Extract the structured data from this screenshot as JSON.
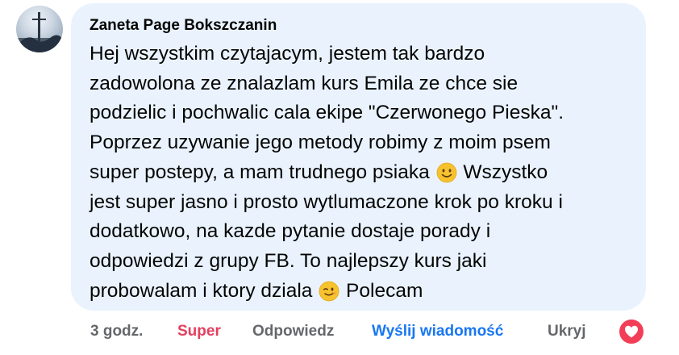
{
  "comment": {
    "author": "Zaneta Page Bokszczanin",
    "lines": {
      "l1": "Hej wszystkim czytajacym, jestem tak bardzo",
      "l2": "zadowolona ze znalazlam kurs Emila ze chce sie",
      "l3": "podzielic i pochwalic cala ekipe \"Czerwonego Pieska\".",
      "l4": "Poprzez uzywanie jego metody robimy z moim psem",
      "l5a": "super postepy, a mam trudnego psiaka ",
      "l5b": " Wszystko",
      "l6": "jest super jasno i prosto wytlumaczone krok po kroku i",
      "l7": "dodatkowo, na kazde pytanie dostaje porady i",
      "l8": "odpowiedzi z grupy FB. To najlepszy kurs jaki",
      "l9a": "probowalam i ktory dziala ",
      "l9b": " Polecam"
    },
    "emojis": {
      "first": "slightly-smiling-face",
      "second": "winking-face"
    }
  },
  "actions": {
    "time": "3 godz.",
    "reaction": "Super",
    "reply": "Odpowiedz",
    "send_message": "Wyślij wiadomość",
    "hide": "Ukryj"
  },
  "reaction_badge": {
    "icon": "heart-icon",
    "color": "#f33e58"
  },
  "colors": {
    "bubble": "#eaf3fd",
    "text": "#050505",
    "muted": "#65676b",
    "reaction": "#e4405f",
    "link": "#1877f2"
  }
}
